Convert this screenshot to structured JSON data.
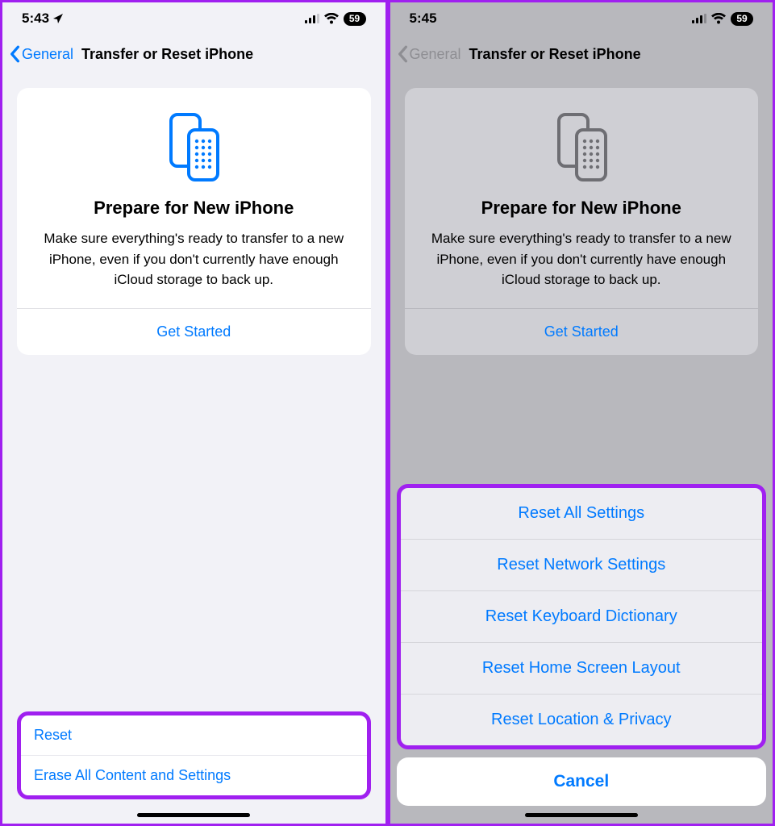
{
  "left": {
    "status": {
      "time": "5:43",
      "battery": "59"
    },
    "nav": {
      "back": "General",
      "title": "Transfer or Reset iPhone"
    },
    "card": {
      "title": "Prepare for New iPhone",
      "desc": "Make sure everything's ready to transfer to a new iPhone, even if you don't currently have enough iCloud storage to back up.",
      "action": "Get Started"
    },
    "list": {
      "reset": "Reset",
      "erase": "Erase All Content and Settings"
    }
  },
  "right": {
    "status": {
      "time": "5:45",
      "battery": "59"
    },
    "nav": {
      "back": "General",
      "title": "Transfer or Reset iPhone"
    },
    "card": {
      "title": "Prepare for New iPhone",
      "desc": "Make sure everything's ready to transfer to a new iPhone, even if you don't currently have enough iCloud storage to back up.",
      "action": "Get Started"
    },
    "sheet": {
      "opt1": "Reset All Settings",
      "opt2": "Reset Network Settings",
      "opt3": "Reset Keyboard Dictionary",
      "opt4": "Reset Home Screen Layout",
      "opt5": "Reset Location & Privacy",
      "cancel": "Cancel"
    }
  }
}
